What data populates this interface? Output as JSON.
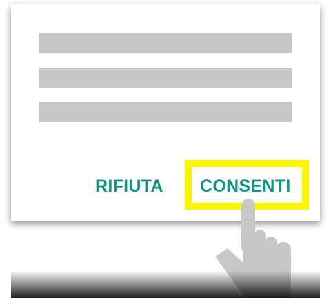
{
  "dialog": {
    "placeholder_lines": 3,
    "buttons": {
      "deny_label": "RIFIUTA",
      "allow_label": "CONSENTI"
    }
  },
  "colors": {
    "button_text": "#0e9384",
    "highlight": "#fbf500",
    "placeholder": "#c8c8c8",
    "hand": "#c8c8c8"
  },
  "icons": {
    "pointer": "hand-pointer-icon"
  }
}
